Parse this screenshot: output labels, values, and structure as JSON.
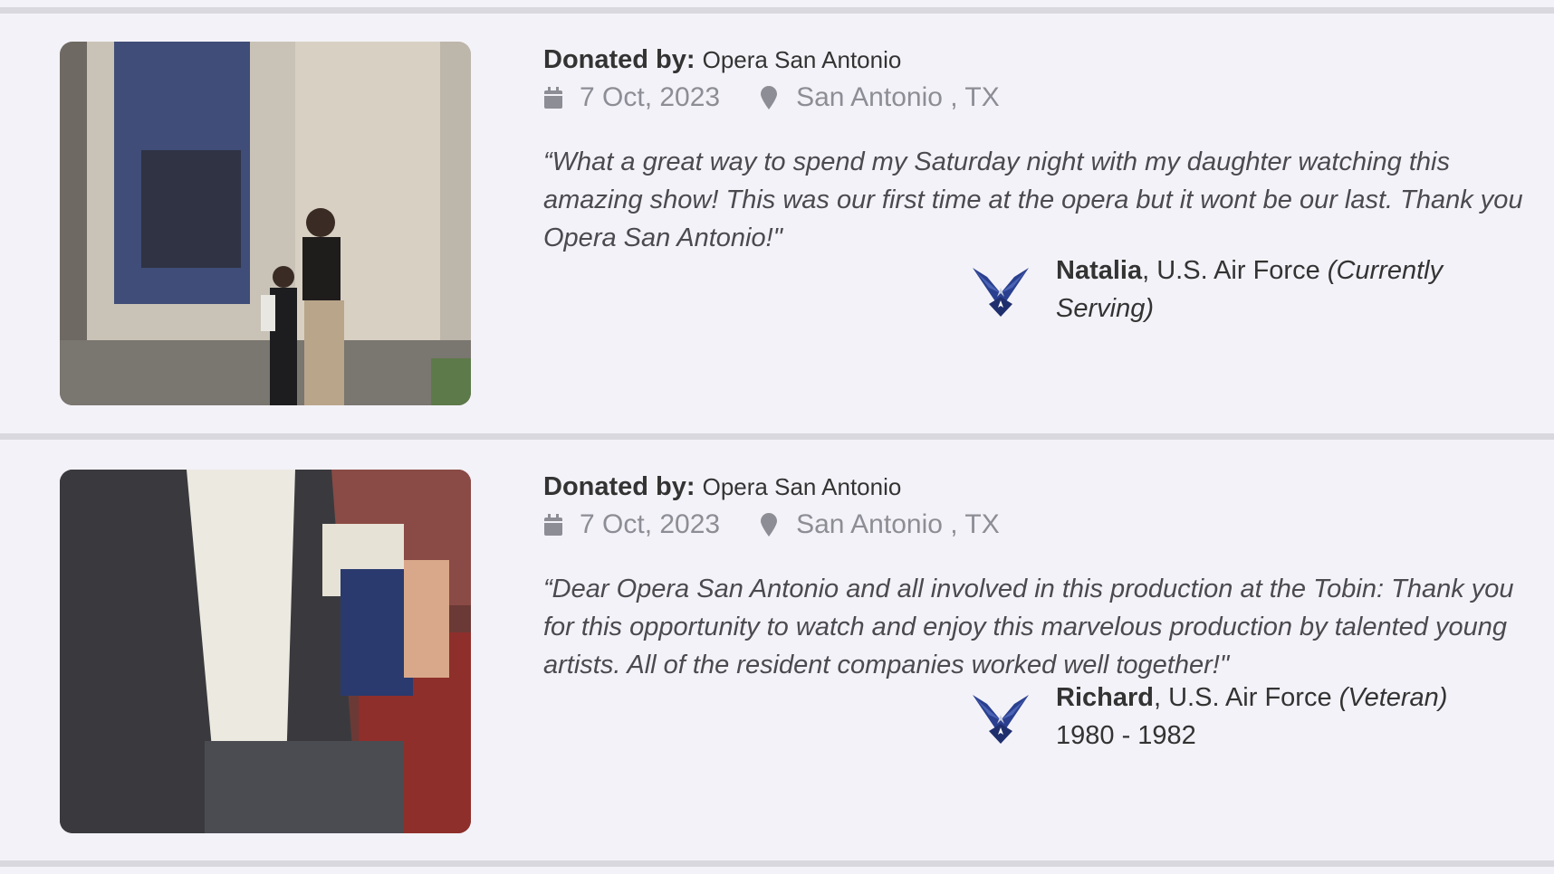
{
  "entries": [
    {
      "donated_label": "Donated by:",
      "donor": "Opera San Antonio",
      "date": "7 Oct, 2023",
      "location": "San Antonio , TX",
      "quote": "“What a great way to spend my Saturday night with my daughter watching this amazing show! This was our first time at the opera but it wont be our last. Thank you Opera San Antonio!\"",
      "name": "Natalia",
      "branch": ", U.S. Air Force ",
      "status": "(Currently Serving)",
      "years": ""
    },
    {
      "donated_label": "Donated by:",
      "donor": "Opera San Antonio",
      "date": "7 Oct, 2023",
      "location": "San Antonio , TX",
      "quote": "“Dear Opera San Antonio and all involved in this production at the Tobin: Thank you for this opportunity to watch and enjoy this marvelous production by talented young artists. All of the resident companies worked well together!\"",
      "name": "Richard",
      "branch": ", U.S. Air Force ",
      "status": "(Veteran)",
      "years": "1980 - 1982"
    }
  ],
  "icons": {
    "date": "calendar-icon",
    "location": "map-pin-icon",
    "branch": "air-force-emblem-icon"
  },
  "colors": {
    "background": "#f3f2f8",
    "divider": "#d9d8df",
    "meta_text": "#8d8d95",
    "emblem_blue": "#2a3f8f"
  }
}
